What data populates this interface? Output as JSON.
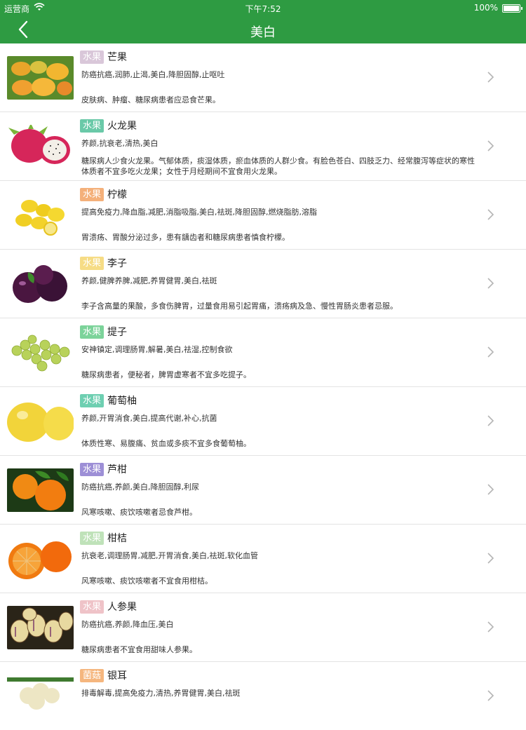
{
  "status_bar": {
    "carrier": "运营商",
    "time": "下午7:52",
    "battery": "100%"
  },
  "nav": {
    "title": "美白"
  },
  "items": [
    {
      "tag": "水果",
      "tag_color": "#d9c7d9",
      "name": "芒果",
      "effects": "防癌抗癌,润肺,止渴,美白,降胆固醇,止呕吐",
      "warning": "皮肤病、肿瘤、糖尿病患者应忌食芒果。"
    },
    {
      "tag": "水果",
      "tag_color": "#6ac9a8",
      "name": "火龙果",
      "effects": "养颜,抗衰老,清热,美白",
      "warning": "糖尿病人少食火龙果。气郁体质，痰湿体质，瘀血体质的人群少食。有脸色苍白、四肢乏力、经常腹泻等症状的寒性体质者不宜多吃火龙果；女性于月经期间不宜食用火龙果。"
    },
    {
      "tag": "水果",
      "tag_color": "#f4b07a",
      "name": "柠檬",
      "effects": "提高免疫力,降血脂,减肥,消脂吸脂,美白,祛斑,降胆固醇,燃烧脂肪,溶脂",
      "warning": "胃溃疡、胃酸分泌过多，患有龋齿者和糖尿病患者慎食柠檬。"
    },
    {
      "tag": "水果",
      "tag_color": "#f6dc85",
      "name": "李子",
      "effects": "养颜,健脾养脾,减肥,养胃健胃,美白,祛斑",
      "warning": "李子含高量的果酸，多食伤脾胃，过量食用易引起胃痛，溃疡病及急、慢性胃肠炎患者忌服。"
    },
    {
      "tag": "水果",
      "tag_color": "#7cd39a",
      "name": "提子",
      "effects": "安神镇定,调理肠胃,解暑,美白,祛湿,控制食欲",
      "warning": "糖尿病患者，便秘者，脾胃虚寒者不宜多吃提子。"
    },
    {
      "tag": "水果",
      "tag_color": "#6ecfb1",
      "name": "葡萄柚",
      "effects": "养颜,开胃消食,美白,提高代谢,补心,抗菌",
      "warning": "体质性寒、易腹痛、贫血或多痰不宜多食葡萄柚。"
    },
    {
      "tag": "水果",
      "tag_color": "#9d8fd6",
      "name": "芦柑",
      "effects": "防癌抗癌,养颜,美白,降胆固醇,利尿",
      "warning": "风寒咳嗽、痰饮咳嗽者忌食芦柑。"
    },
    {
      "tag": "水果",
      "tag_color": "#bfe2b9",
      "name": "柑桔",
      "effects": "抗衰老,调理肠胃,减肥,开胃消食,美白,祛斑,软化血管",
      "warning": "风寒咳嗽、痰饮咳嗽者不宜食用柑桔。"
    },
    {
      "tag": "水果",
      "tag_color": "#efc3c8",
      "name": "人参果",
      "effects": "防癌抗癌,养颜,降血压,美白",
      "warning": "糖尿病患者不宜食用甜味人参果。"
    },
    {
      "tag": "菌菇",
      "tag_color": "#f5b67e",
      "name": "银耳",
      "effects": "排毒解毒,提高免疫力,清热,养胃健胃,美白,祛斑",
      "warning": ""
    }
  ]
}
